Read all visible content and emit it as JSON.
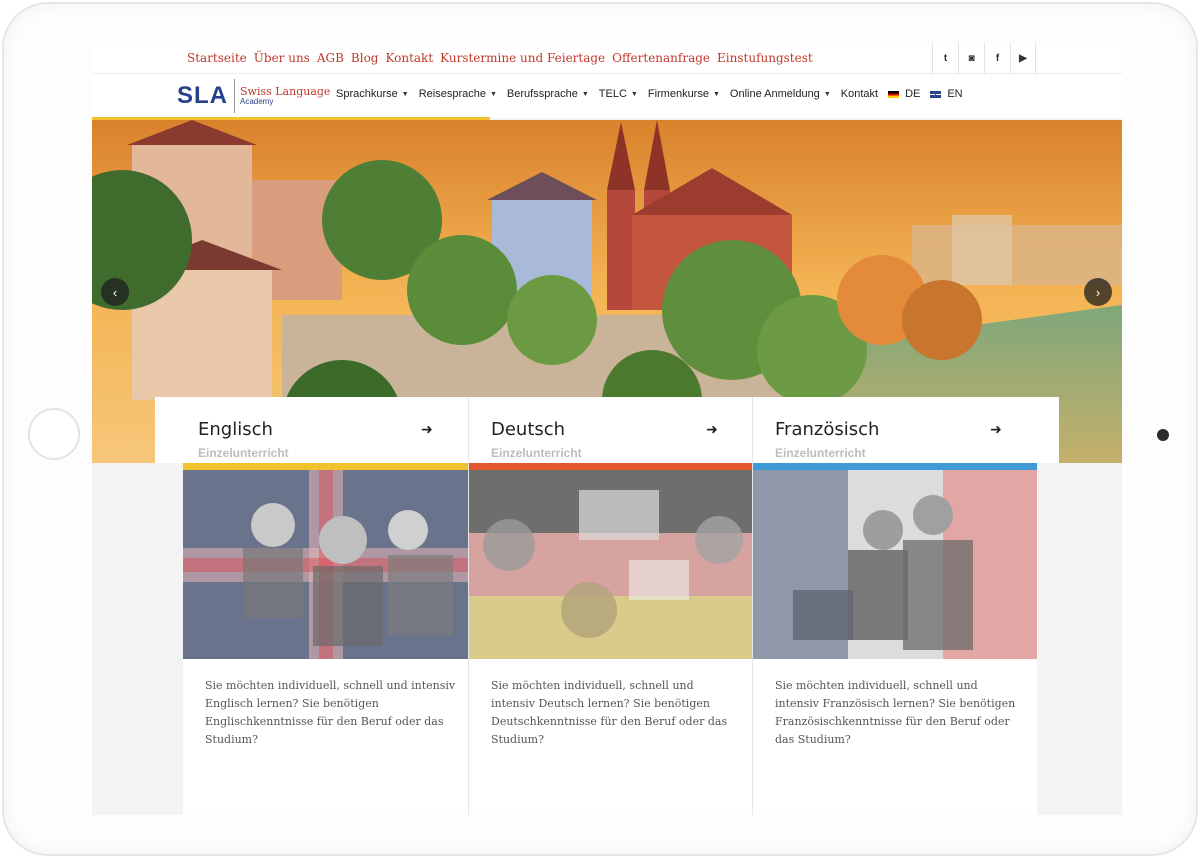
{
  "top_links": [
    "Startseite",
    "Über uns",
    "AGB",
    "Blog",
    "Kontakt",
    "Kurstermine und Feiertage",
    "Offertenanfrage",
    "Einstufungstest"
  ],
  "social_icons": [
    {
      "name": "twitter-icon",
      "glyph": "t"
    },
    {
      "name": "instagram-icon",
      "glyph": "◙"
    },
    {
      "name": "facebook-icon",
      "glyph": "f"
    },
    {
      "name": "youtube-icon",
      "glyph": "▶"
    }
  ],
  "logo": {
    "abbr": "SLA",
    "name": "Swiss Language",
    "sub": "Academy"
  },
  "menu": [
    {
      "label": "Sprachkurse",
      "dropdown": true
    },
    {
      "label": "Reisesprache",
      "dropdown": true
    },
    {
      "label": "Berufssprache",
      "dropdown": true
    },
    {
      "label": "TELC",
      "dropdown": true
    },
    {
      "label": "Firmenkurse",
      "dropdown": true
    },
    {
      "label": "Online Anmeldung",
      "dropdown": true
    },
    {
      "label": "Kontakt",
      "dropdown": false
    }
  ],
  "languages": {
    "de": "DE",
    "en": "EN"
  },
  "hero": {
    "prev": "‹",
    "next": "›"
  },
  "cards": [
    {
      "title": "Englisch",
      "subtitle": "Einzelunterricht",
      "arrow": "➜",
      "stripe_color": "#f2c12e",
      "text": "Sie möchten individuell, schnell und intensiv Englisch lernen? Sie benötigen Englischkenntnisse für den Beruf oder das Studium?"
    },
    {
      "title": "Deutsch",
      "subtitle": "Einzelunterricht",
      "arrow": "➜",
      "stripe_color": "#e2572b",
      "text": "Sie möchten individuell, schnell und intensiv Deutsch lernen? Sie benötigen Deutschkenntnisse für den Beruf oder das Studium?"
    },
    {
      "title": "Französisch",
      "subtitle": "Einzelunterricht",
      "arrow": "➜",
      "stripe_color": "#3f9ad6",
      "text": "Sie möchten individuell, schnell und intensiv Französisch lernen? Sie benötigen Französischkenntnisse für den Beruf oder das Studium?"
    }
  ]
}
